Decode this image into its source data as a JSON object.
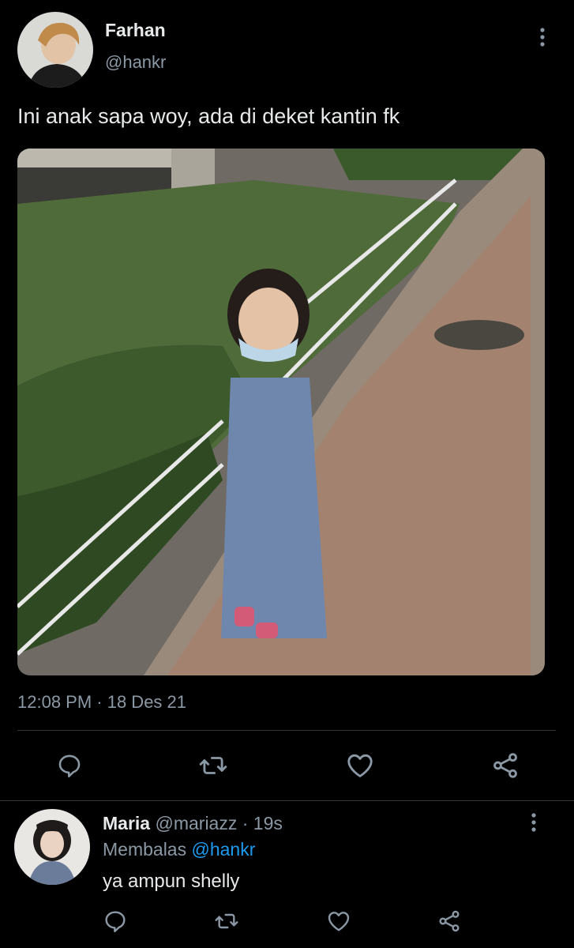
{
  "tweet": {
    "author_name": "Farhan",
    "author_handle": "@hankr",
    "text": "Ini anak sapa woy, ada di deket kantin fk",
    "timestamp": "12:08 PM · 18 Des 21",
    "photo_icon": "photo-of-girl-on-brick-sidewalk",
    "actions": [
      "reply-icon",
      "retweet-icon",
      "like-icon",
      "share-icon"
    ]
  },
  "reply": {
    "author_name": "Maria",
    "author_handle": "@mariazz",
    "separator": "·",
    "age": "19s",
    "replying_prefix": "Membalas",
    "replying_to": "@hankr",
    "text": "ya ampun shelly",
    "actions": [
      "reply-icon",
      "retweet-icon",
      "like-icon",
      "share-icon"
    ]
  },
  "colors": {
    "background": "#000000",
    "text": "#e7e9ea",
    "muted": "#8b98a5",
    "link": "#1d9bf0",
    "divider": "#2f3336"
  }
}
